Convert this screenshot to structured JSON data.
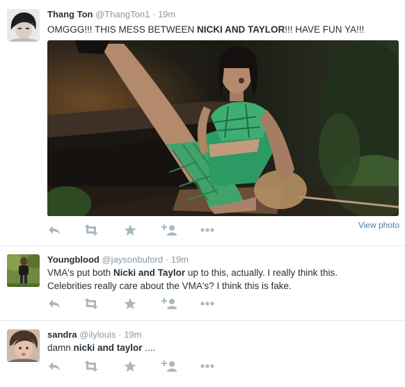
{
  "tweets": [
    {
      "name": "Thang Ton",
      "handle": "@ThangTon1",
      "separator": "·",
      "time": "19m",
      "text_parts": [
        "OMGGG!!! THIS MESS BETWEEN ",
        "NICKI AND TAYLOR",
        "!!! HAVE FUN YA!!!"
      ],
      "view_photo": "View photo"
    },
    {
      "name": "Youngblood",
      "handle": "@jaysonbuford",
      "separator": "·",
      "time": "19m",
      "text_parts": [
        "VMA's put both ",
        "Nicki and Taylor",
        " up to this, actually. I really think this.",
        "Celebrities really care about the VMA's? I think this is fake."
      ]
    },
    {
      "name": "sandra",
      "handle": "@ilylouis",
      "separator": "·",
      "time": "19m",
      "text_parts": [
        "damn ",
        "nicki and taylor",
        " ...."
      ]
    }
  ],
  "icons": {
    "reply": "reply-icon",
    "retweet": "retweet-icon",
    "favorite": "favorite-star-icon",
    "follow": "follow-person-icon",
    "more": "more-dots-icon"
  },
  "colors": {
    "text": "#292f33",
    "meta": "#8899a6",
    "action": "#aab8c2",
    "link": "#4f7aa2",
    "divider": "#e1e8ed"
  }
}
